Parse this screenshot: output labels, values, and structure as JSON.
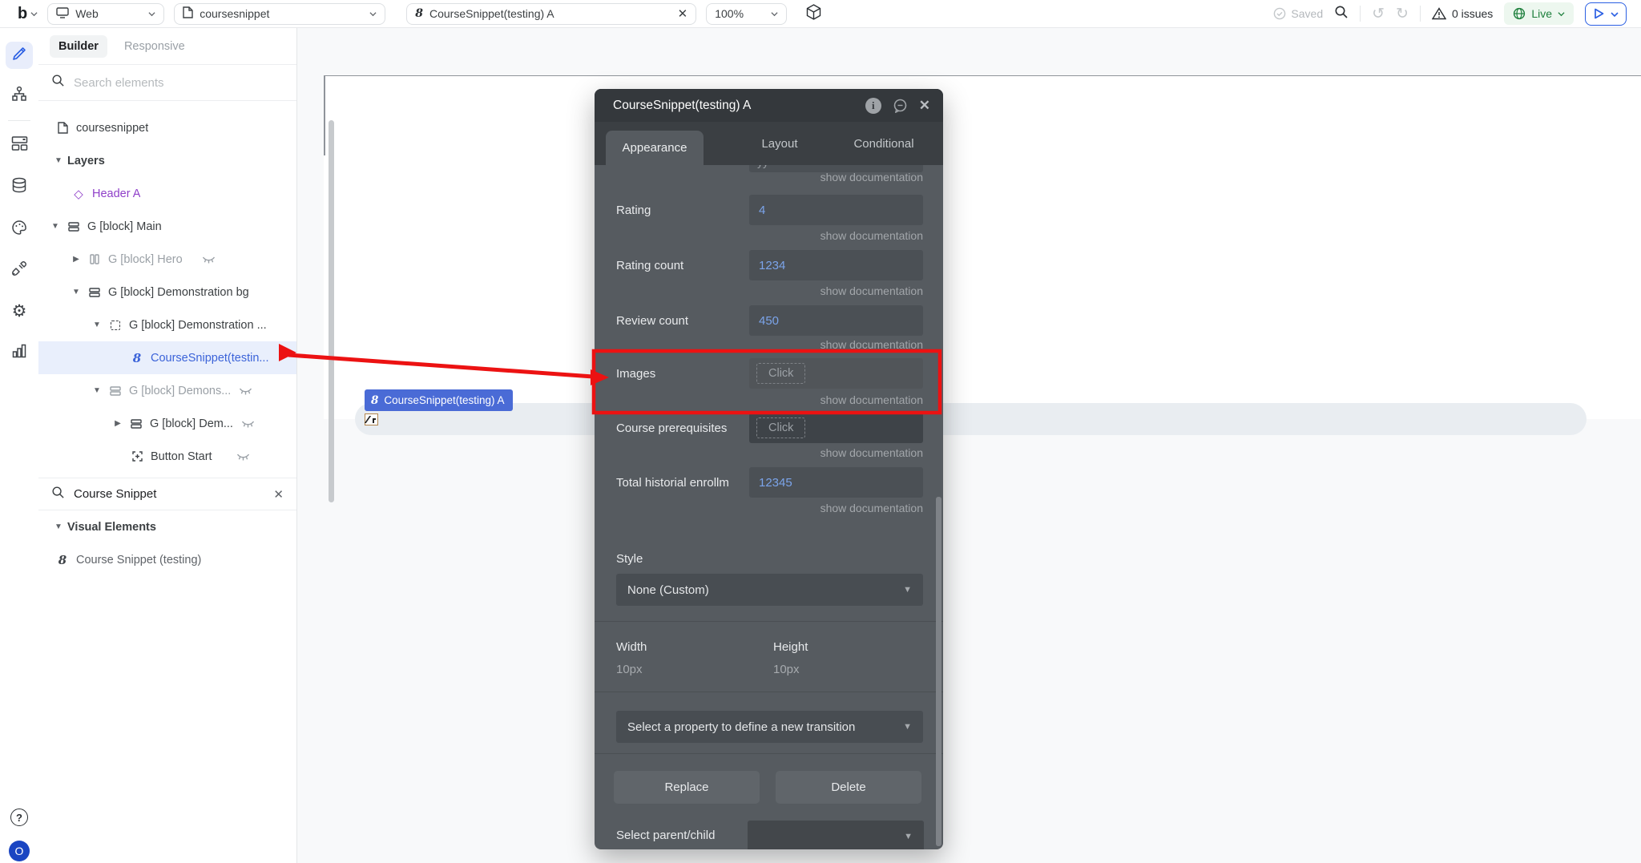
{
  "toolbar": {
    "logo": "b",
    "device": "Web",
    "page_name": "coursesnippet",
    "open_tab": "CourseSnippet(testing) A",
    "zoom": "100%",
    "saved": "Saved",
    "issues": "0 issues",
    "live": "Live"
  },
  "left_panel": {
    "tabs": {
      "builder": "Builder",
      "responsive": "Responsive"
    },
    "search_placeholder": "Search elements",
    "component_search_value": "Course Snippet",
    "tree": {
      "root": "coursesnippet",
      "layers_label": "Layers",
      "items": [
        {
          "label": "Header A"
        },
        {
          "label": "G [block] Main"
        },
        {
          "label": "G [block] Hero"
        },
        {
          "label": "G [block] Demonstration bg"
        },
        {
          "label": "G [block] Demonstration ..."
        },
        {
          "label": "CourseSnippet(testin..."
        },
        {
          "label": "G [block] Demons..."
        },
        {
          "label": "G [block] Dem..."
        },
        {
          "label": "Button Start"
        }
      ]
    },
    "components": {
      "group": "Visual Elements",
      "item": "Course Snippet (testing)"
    }
  },
  "canvas": {
    "badge": "CourseSnippet(testing) A",
    "component_glyph": "8"
  },
  "panel": {
    "title": "CourseSnippet(testing) A",
    "tabs": [
      "Appearance",
      "Layout",
      "Conditional"
    ],
    "show_doc": "show documentation",
    "fields": [
      {
        "label": "Rating",
        "value": "4"
      },
      {
        "label": "Rating count",
        "value": "1234"
      },
      {
        "label": "Review count",
        "value": "450"
      },
      {
        "label": "Images",
        "value": "Click"
      },
      {
        "label": "Course prerequisites",
        "value": "Click"
      },
      {
        "label": "Total historial enrollm",
        "value": "12345"
      }
    ],
    "style_label": "Style",
    "style_value": "None (Custom)",
    "width_label": "Width",
    "width_value": "10px",
    "height_label": "Height",
    "height_value": "10px",
    "transition_placeholder": "Select a property to define a new transition",
    "replace": "Replace",
    "delete": "Delete",
    "parent_child": "Select parent/child"
  },
  "misc": {
    "help": "?",
    "avatar": "O"
  },
  "colors": {
    "accent_blue": "#2b5fe3",
    "layer_blue": "#3b63d9",
    "purple": "#8f3fc9",
    "panel_body": "#565b60",
    "badge_blue": "#4a6bd6",
    "annotation_red": "#ec1212",
    "live_green": "#1d7f3c"
  }
}
